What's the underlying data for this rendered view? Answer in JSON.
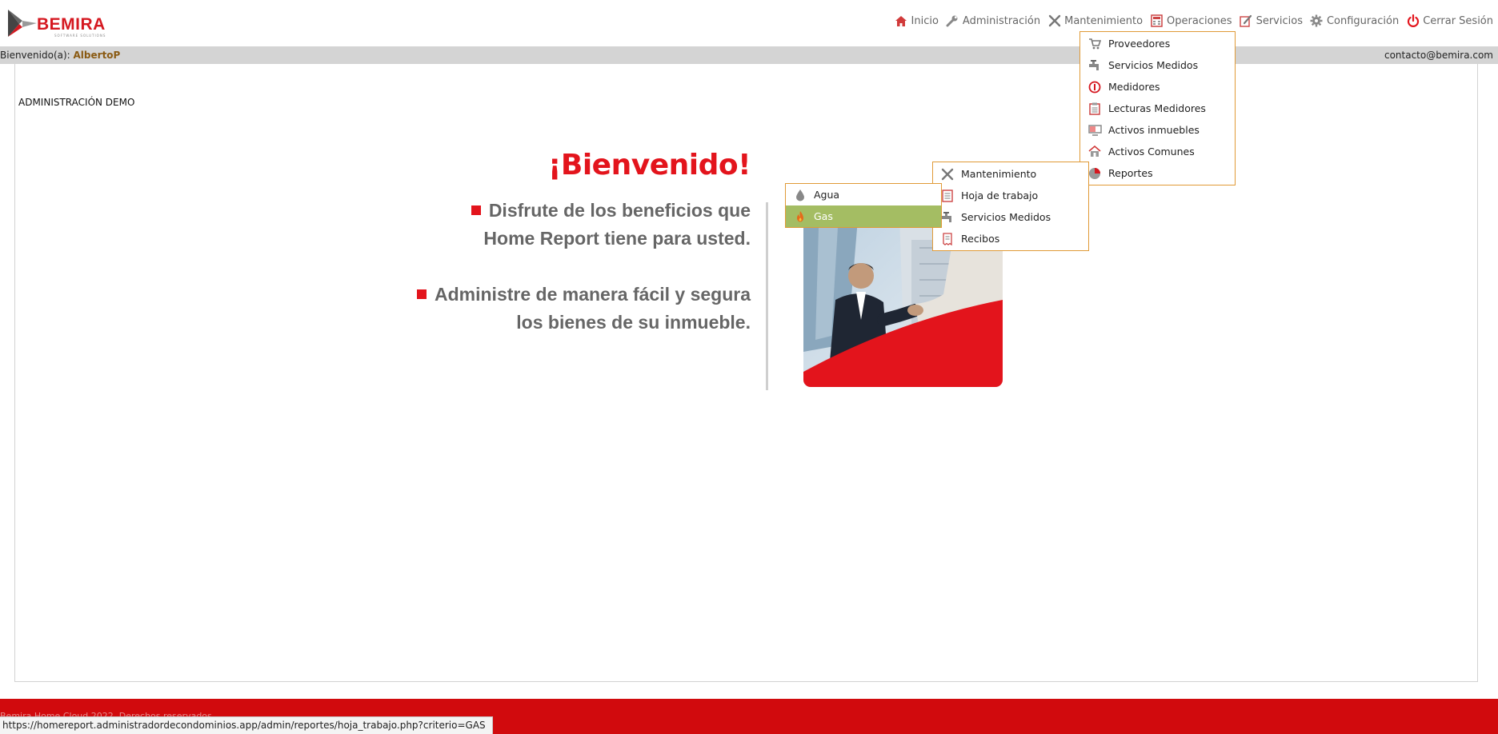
{
  "brand": {
    "name": "BEMIRA",
    "tagline": "SOFTWARE SOLUTIONS",
    "accent": "#e3141c"
  },
  "nav": {
    "items": [
      {
        "label": "Inicio",
        "icon": "home-icon"
      },
      {
        "label": "Administración",
        "icon": "wrench-icon"
      },
      {
        "label": "Mantenimiento",
        "icon": "tools-icon"
      },
      {
        "label": "Operaciones",
        "icon": "calculator-icon"
      },
      {
        "label": "Servicios",
        "icon": "edit-icon"
      },
      {
        "label": "Configuración",
        "icon": "gear-icon"
      },
      {
        "label": "Cerrar Sesión",
        "icon": "power-icon"
      }
    ]
  },
  "welcome_bar": {
    "prefix": "Bienvenido(a): ",
    "user": "AlbertoP",
    "contact": "contacto@bemira.com"
  },
  "main": {
    "admin_label": "ADMINISTRACIÓN DEMO",
    "headline": "¡Bienvenido!",
    "benefit1_line1": "Disfrute de los beneficios que",
    "benefit1_line2": "Home Report tiene para usted.",
    "benefit2_line1": "Administre de manera fácil y segura",
    "benefit2_line2": "los bienes de su inmueble."
  },
  "mantenimiento_menu": {
    "items": [
      {
        "label": "Proveedores",
        "icon": "cart-icon"
      },
      {
        "label": "Servicios Medidos",
        "icon": "faucet-icon"
      },
      {
        "label": "Medidores",
        "icon": "meter-icon"
      },
      {
        "label": "Lecturas Medidores",
        "icon": "clipboard-icon"
      },
      {
        "label": "Activos inmuebles",
        "icon": "monitor-icon"
      },
      {
        "label": "Activos Comunes",
        "icon": "house-icon"
      },
      {
        "label": "Reportes",
        "icon": "chart-pie-icon"
      }
    ]
  },
  "reportes_menu": {
    "items": [
      {
        "label": "Mantenimiento",
        "icon": "tools-icon"
      },
      {
        "label": "Hoja de trabajo",
        "icon": "document-icon"
      },
      {
        "label": "Servicios Medidos",
        "icon": "faucet-icon"
      },
      {
        "label": "Recibos",
        "icon": "receipt-icon"
      }
    ]
  },
  "servicios_menu": {
    "items": [
      {
        "label": "Agua",
        "icon": "water-drop-icon",
        "active": false
      },
      {
        "label": "Gas",
        "icon": "flame-icon",
        "active": true
      }
    ],
    "active_color": "#a4bd63"
  },
  "footer": {
    "text": "Bemira Home Cloud 2022. Derechos reservados",
    "color": "#d10a0d"
  },
  "status_url": "https://homereport.administradordecondominios.app/admin/reportes/hoja_trabajo.php?criterio=GAS"
}
